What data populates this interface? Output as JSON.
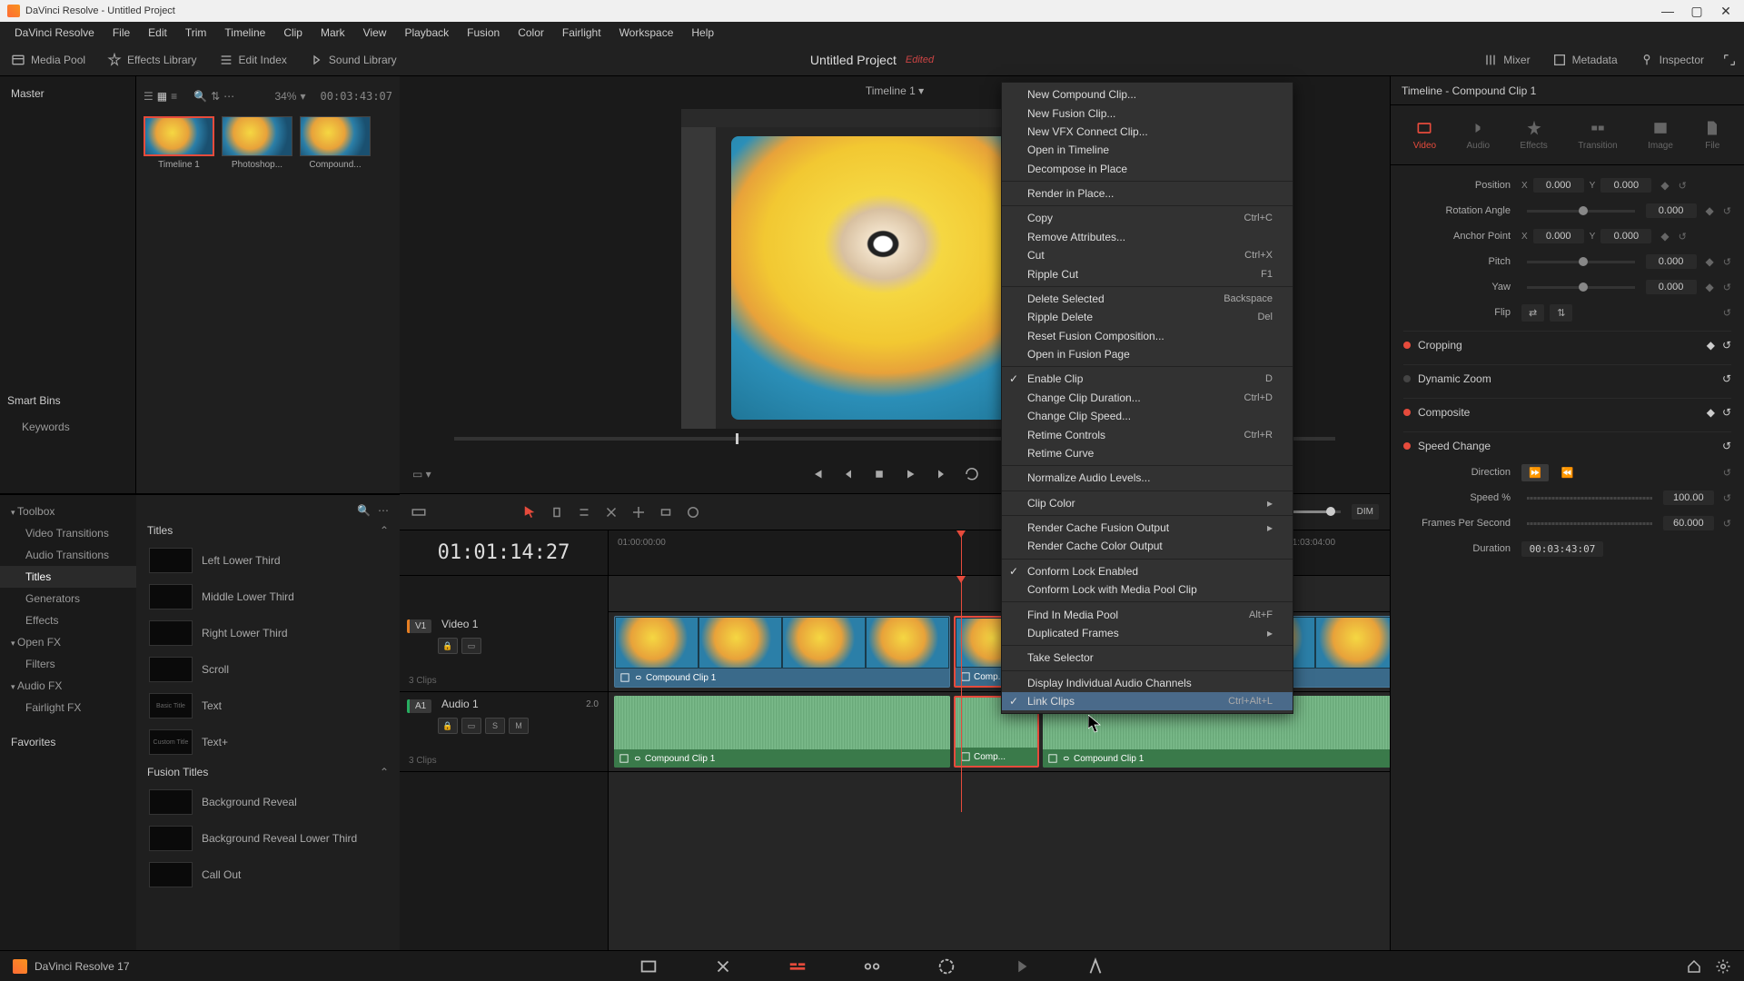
{
  "titlebar": {
    "text": "DaVinci Resolve - Untitled Project"
  },
  "menubar": [
    "DaVinci Resolve",
    "File",
    "Edit",
    "Trim",
    "Timeline",
    "Clip",
    "Mark",
    "View",
    "Playback",
    "Fusion",
    "Color",
    "Fairlight",
    "Workspace",
    "Help"
  ],
  "toolbar": {
    "media_pool": "Media Pool",
    "effects_library": "Effects Library",
    "edit_index": "Edit Index",
    "sound_library": "Sound Library",
    "project": "Untitled Project",
    "edited": "Edited",
    "mixer": "Mixer",
    "metadata": "Metadata",
    "inspector": "Inspector"
  },
  "media": {
    "master": "Master",
    "zoom": "34%",
    "duration": "00:03:43:07",
    "clips": [
      {
        "name": "Timeline 1",
        "selected": true
      },
      {
        "name": "Photoshop..."
      },
      {
        "name": "Compound..."
      }
    ],
    "smart_bins": "Smart Bins",
    "keywords": "Keywords"
  },
  "effects": {
    "sidebar": [
      {
        "label": "Toolbox",
        "expandable": true
      },
      {
        "label": "Video Transitions",
        "sub": true
      },
      {
        "label": "Audio Transitions",
        "sub": true
      },
      {
        "label": "Titles",
        "sub": true,
        "active": true
      },
      {
        "label": "Generators",
        "sub": true
      },
      {
        "label": "Effects",
        "sub": true
      },
      {
        "label": "Open FX",
        "expandable": true
      },
      {
        "label": "Filters",
        "sub": true
      },
      {
        "label": "Audio FX",
        "expandable": true
      },
      {
        "label": "Fairlight FX",
        "sub": true
      }
    ],
    "favorites": "Favorites",
    "section1": "Titles",
    "items1": [
      "Left Lower Third",
      "Middle Lower Third",
      "Right Lower Third",
      "Scroll",
      "Text",
      "Text+"
    ],
    "section2": "Fusion Titles",
    "items2": [
      "Background Reveal",
      "Background Reveal Lower Third",
      "Call Out"
    ]
  },
  "viewer": {
    "timeline_name": "Timeline 1"
  },
  "timeline": {
    "timecode": "01:01:14:27",
    "start_tc": "01:00:00:00",
    "end_tc": "01:03:04:00",
    "dim": "DIM",
    "video_track": {
      "tag": "V1",
      "name": "Video 1",
      "info": "3 Clips"
    },
    "audio_track": {
      "tag": "A1",
      "name": "Audio 1",
      "info": "3 Clips",
      "chan": "2.0",
      "solo": "S",
      "mute": "M"
    },
    "clip_name": "Compound Clip 1",
    "clip_short": "Comp..."
  },
  "inspector": {
    "title": "Timeline - Compound Clip 1",
    "tabs": [
      "Video",
      "Audio",
      "Effects",
      "Transition",
      "Image",
      "File"
    ],
    "position": "Position",
    "pos_x": "0.000",
    "pos_y": "0.000",
    "rotation": "Rotation Angle",
    "rot_val": "0.000",
    "anchor": "Anchor Point",
    "anc_x": "0.000",
    "anc_y": "0.000",
    "pitch": "Pitch",
    "pitch_val": "0.000",
    "yaw": "Yaw",
    "yaw_val": "0.000",
    "flip": "Flip",
    "cropping": "Cropping",
    "dynamic_zoom": "Dynamic Zoom",
    "composite": "Composite",
    "speed_change": "Speed Change",
    "direction": "Direction",
    "speed": "Speed %",
    "speed_val": "100.00",
    "fps": "Frames Per Second",
    "fps_val": "60.000",
    "dur": "Duration",
    "dur_val": "00:03:43:07"
  },
  "context_menu": [
    {
      "label": "New Compound Clip..."
    },
    {
      "label": "New Fusion Clip..."
    },
    {
      "label": "New VFX Connect Clip..."
    },
    {
      "label": "Open in Timeline"
    },
    {
      "label": "Decompose in Place"
    },
    {
      "sep": true
    },
    {
      "label": "Render in Place..."
    },
    {
      "sep": true
    },
    {
      "label": "Copy",
      "shortcut": "Ctrl+C"
    },
    {
      "label": "Remove Attributes..."
    },
    {
      "label": "Cut",
      "shortcut": "Ctrl+X"
    },
    {
      "label": "Ripple Cut",
      "shortcut": "F1"
    },
    {
      "sep": true
    },
    {
      "label": "Delete Selected",
      "shortcut": "Backspace"
    },
    {
      "label": "Ripple Delete",
      "shortcut": "Del"
    },
    {
      "label": "Reset Fusion Composition..."
    },
    {
      "label": "Open in Fusion Page"
    },
    {
      "sep": true
    },
    {
      "label": "Enable Clip",
      "shortcut": "D",
      "check": true
    },
    {
      "label": "Change Clip Duration...",
      "shortcut": "Ctrl+D"
    },
    {
      "label": "Change Clip Speed..."
    },
    {
      "label": "Retime Controls",
      "shortcut": "Ctrl+R"
    },
    {
      "label": "Retime Curve"
    },
    {
      "sep": true
    },
    {
      "label": "Normalize Audio Levels..."
    },
    {
      "sep": true
    },
    {
      "label": "Clip Color",
      "arrow": true
    },
    {
      "sep": true
    },
    {
      "label": "Render Cache Fusion Output",
      "arrow": true
    },
    {
      "label": "Render Cache Color Output"
    },
    {
      "sep": true
    },
    {
      "label": "Conform Lock Enabled",
      "check": true
    },
    {
      "label": "Conform Lock with Media Pool Clip"
    },
    {
      "sep": true
    },
    {
      "label": "Find In Media Pool",
      "shortcut": "Alt+F"
    },
    {
      "label": "Duplicated Frames",
      "arrow": true
    },
    {
      "sep": true
    },
    {
      "label": "Take Selector"
    },
    {
      "sep": true
    },
    {
      "label": "Display Individual Audio Channels"
    },
    {
      "label": "Link Clips",
      "shortcut": "Ctrl+Alt+L",
      "check": true,
      "highlighted": true
    }
  ],
  "bottombar": {
    "version": "DaVinci Resolve 17"
  }
}
